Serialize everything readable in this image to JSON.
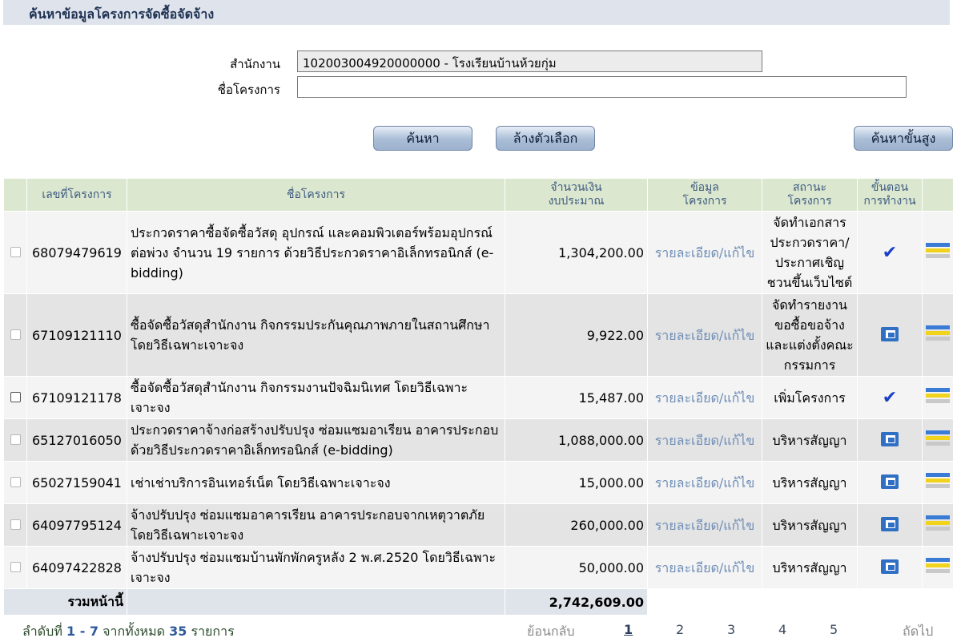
{
  "header": {
    "title": "ค้นหาข้อมูลโครงการจัดซื้อจัดจ้าง"
  },
  "form": {
    "office_label": "สำนักงาน",
    "office_value": "102003004920000000 - โรงเรียนบ้านห้วยกุ่ม",
    "project_label": "ชื่อโครงการ",
    "project_value": ""
  },
  "buttons": {
    "search": "ค้นหา",
    "clear": "ล้างตัวเลือก",
    "advanced": "ค้นหาขั้นสูง"
  },
  "table": {
    "headers": {
      "number": "เลขที่โครงการ",
      "name": "ชื่อโครงการ",
      "budget_1": "จำนวนเงิน",
      "budget_2": "งบประมาณ",
      "info_1": "ข้อมูล",
      "info_2": "โครงการ",
      "status_1": "สถานะ",
      "status_2": "โครงการ",
      "step_1": "ขั้นตอน",
      "step_2": "การทำงาน"
    },
    "rows": [
      {
        "number": "68079479619",
        "name": "ประกวดราคาซื้อจัดซื้อวัสดุ อุปกรณ์ และคอมพิวเตอร์พร้อมอุปกรณ์ต่อพ่วง จำนวน 19 รายการ ด้วยวิธีประกวดราคาอิเล็กทรอนิกส์ (e-bidding)",
        "budget": "1,304,200.00",
        "link": "รายละเอียด/แก้ไข",
        "status": "จัดทำเอกสารประกวดราคา/ประกาศเชิญชวนขึ้นเว็บไซต์",
        "step_icon": "checkmark-icon"
      },
      {
        "number": "67109121110",
        "name": "ซื้อจัดซื้อวัสดุสำนักงาน กิจกรรมประกันคุณภาพภายในสถานศึกษา โดยวิธีเฉพาะเจาะจง",
        "budget": "9,922.00",
        "link": "รายละเอียด/แก้ไข",
        "status": "จัดทำรายงานขอซื้อขอจ้างและแต่งตั้งคณะกรรมการ",
        "step_icon": "process-icon"
      },
      {
        "number": "67109121178",
        "name": "ซื้อจัดซื้อวัสดุสำนักงาน กิจกรรมงานปัจฉิมนิเทศ โดยวิธีเฉพาะเจาะจง",
        "budget": "15,487.00",
        "link": "รายละเอียด/แก้ไข",
        "status": "เพิ่มโครงการ",
        "step_icon": "checkmark-icon"
      },
      {
        "number": "65127016050",
        "name": "ประกวดราคาจ้างก่อสร้างปรับปรุง ซ่อมแซมอาเรียน อาคารประกอบ ด้วยวิธีประกวดราคาอิเล็กทรอนิกส์ (e-bidding)",
        "budget": "1,088,000.00",
        "link": "รายละเอียด/แก้ไข",
        "status": "บริหารสัญญา",
        "step_icon": "process-icon"
      },
      {
        "number": "65027159041",
        "name": "เช่าเช่าบริการอินเทอร์เน็ต โดยวิธีเฉพาะเจาะจง",
        "budget": "15,000.00",
        "link": "รายละเอียด/แก้ไข",
        "status": "บริหารสัญญา",
        "step_icon": "process-icon"
      },
      {
        "number": "64097795124",
        "name": "จ้างปรับปรุง ซ่อมแซมอาคารเรียน อาคารประกอบจากเหตุวาตภัย โดยวิธีเฉพาะเจาะจง",
        "budget": "260,000.00",
        "link": "รายละเอียด/แก้ไข",
        "status": "บริหารสัญญา",
        "step_icon": "process-icon"
      },
      {
        "number": "64097422828",
        "name": "จ้างปรับปรุง ซ่อมแซมบ้านพักพักครูหลัง 2 พ.ศ.2520 โดยวิธีเฉพาะเจาะจง",
        "budget": "50,000.00",
        "link": "รายละเอียด/แก้ไข",
        "status": "บริหารสัญญา",
        "step_icon": "process-icon"
      }
    ],
    "total_label": "รวมหน้านี้",
    "total_value": "2,742,609.00"
  },
  "footer": {
    "summary_prefix": "ลำดับที่",
    "summary_range": "1 - 7",
    "summary_middle": "จากทั้งหมด",
    "summary_total": "35",
    "summary_suffix": "รายการ",
    "prev": "ย้อนกลับ",
    "pages": [
      "1",
      "2",
      "3",
      "4",
      "5"
    ],
    "next": "ถัดไป"
  },
  "colors": {
    "header_bg": "#dfe4ec",
    "table_header_bg": "#dbe7cf",
    "link": "#6e8db6",
    "check": "#1a3fc8",
    "process": "#2f6fc4"
  }
}
